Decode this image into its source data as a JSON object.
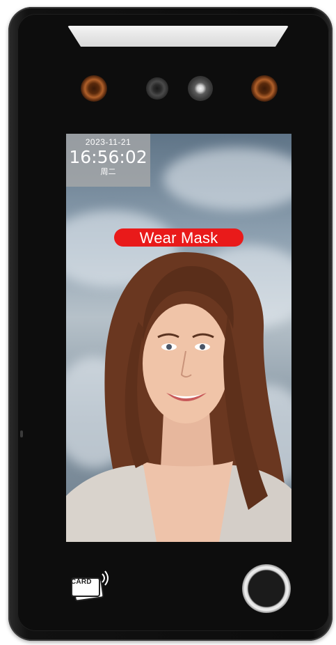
{
  "screen": {
    "clock": {
      "date": "2023-11-21",
      "time": "16:56:02",
      "weekday": "周二"
    },
    "alert": {
      "text": "Wear Mask",
      "color": "#e91a1a"
    }
  },
  "controls": {
    "card_reader": {
      "label": "CARD",
      "icon": "card-reader-icon"
    },
    "fingerprint": {
      "icon": "fingerprint-sensor-icon"
    }
  },
  "sensors": {
    "top_light": "fill-light-bar",
    "left_led": "infrared-led-icon",
    "right_led": "infrared-led-icon",
    "small_camera": "camera-icon",
    "main_camera": "camera-icon"
  }
}
